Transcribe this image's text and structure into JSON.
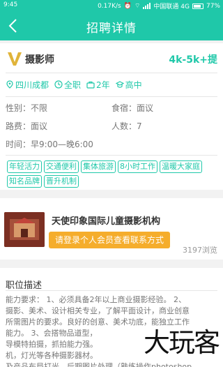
{
  "status_bar": {
    "time": "9:45",
    "speed": "0.17K/s",
    "carrier": "中国联通 4G",
    "battery": "77%"
  },
  "nav": {
    "title": "招聘详情",
    "back_icon": "back-arrow-icon"
  },
  "job": {
    "title": "摄影师",
    "salary": "4k-5k+提",
    "location": "四川成都",
    "type": "全职",
    "experience": "2年",
    "education": "高中",
    "gender_label": "性别：",
    "gender_value": "不限",
    "board_label": "食宿：",
    "board_value": "面议",
    "travel_label": "路费：",
    "travel_value": "面议",
    "headcount_label": "人数：",
    "headcount_value": "7",
    "time_label": "时间：",
    "time_value": "早9:00—晚6:00",
    "benefits": [
      "年轻活力",
      "交通便利",
      "集体旅游",
      "8小时工作",
      "温暖大家庭",
      "知名品牌",
      "晋升机制"
    ]
  },
  "company": {
    "name": "天使印象国际儿童摄影机构",
    "login_prompt": "请登录个人会员查看联系方式",
    "views": "3197浏览"
  },
  "description": {
    "title": "职位描述",
    "lines": [
      "能力要求：  1、必须具备2年以上商业摄影经验。 2、",
      "摄影、美术、设计相关专业，了解平面设计，商业创意",
      "所需图片的要求。良好的创意、美术功底，能独立工作",
      "能力。  3、会搭物品道型，",
      "导模特拍摄，抓拍能力强。",
      "机，灯光等各种摄影器材。",
      "及产品布局打光、后期图片处理（熟练操作photoshop"
    ]
  },
  "watermark": {
    "text": "大玩客"
  },
  "colors": {
    "accent": "#1fc8a9",
    "button": "#f5ad2c",
    "logo": "#e0b43a"
  }
}
